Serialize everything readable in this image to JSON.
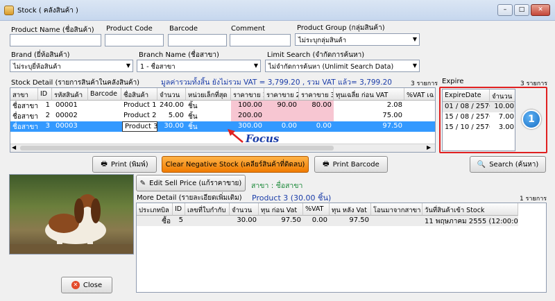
{
  "window": {
    "title": "Stock ( คลังสินค้า )",
    "min": "–",
    "max": "□",
    "close": "✕"
  },
  "filters": {
    "product_name_label": "Product Name (ชื่อสินค้า)",
    "product_code_label": "Product Code",
    "barcode_label": "Barcode",
    "comment_label": "Comment",
    "product_group_label": "Product Group (กลุ่มสินค้า)",
    "product_group_value": "ไม่ระบุกลุ่มสินค้า",
    "brand_label": "Brand (ยี่ห้อสินค้า)",
    "brand_value": "ไม่ระบุยี่ห้อสินค้า",
    "branch_label": "Branch Name (ชื่อสาขา)",
    "branch_value": "1 - ชื่อสาขา",
    "limit_label": "Limit Search (จำกัดการค้นหา)",
    "limit_value": "ไม่จำกัดการค้นหา (Unlimit Search Data)"
  },
  "stock": {
    "label": "Stock Detail (รายการสินค้าในคลังสินค้า)",
    "summary": "มูลค่ารวมทั้งสิ้น ยังไม่รวม VAT = 3,799.20 , รวม VAT แล้ว= 3,799.20",
    "count": "3 รายการ",
    "headers": [
      "สาขา",
      "ID",
      "รหัสสินค้า",
      "Barcode",
      "ชื่อสินค้า",
      "จำนวน",
      "หน่วยเล็กที่สุด",
      "ราคาขาย 1",
      "ราคาขาย 2",
      "ราคาขาย 3",
      "ทุนเฉลี่ย ก่อน VAT",
      "%VAT เฉ"
    ],
    "rows": [
      [
        "ชื่อสาขา",
        "1",
        "00001",
        "Product 1",
        "240.00",
        "ชิ้น",
        "100.00",
        "90.00",
        "80.00",
        "2.08"
      ],
      [
        "ชื่อสาขา",
        "2",
        "00002",
        "Product 2",
        "5.00",
        "ชิ้น",
        "200.00",
        "0.00",
        "0.00",
        "75.00"
      ],
      [
        "ชื่อสาขา",
        "3",
        "00003",
        "Product 3",
        "30.00",
        "ชิ้น",
        "300.00",
        "0.00",
        "0.00",
        "97.50"
      ]
    ],
    "focus_label": "Focus"
  },
  "expire": {
    "label": "Expire",
    "count": "3 รายการ",
    "headers": [
      "ExpireDate",
      "จำนวน"
    ],
    "rows": [
      [
        "01 / 08 / 2570",
        "10.00"
      ],
      [
        "15 / 08 / 2570",
        "7.00"
      ],
      [
        "15 / 10 / 2570",
        "3.00"
      ]
    ],
    "badge": "1",
    "highlight_color": "#e02020"
  },
  "buttons": {
    "print": "Print (พิมพ์)",
    "clear_negative": "Clear Negative Stock (เคลียร์สินค้าที่ติดลบ)",
    "print_barcode": "Print Barcode",
    "search": "Search (ค้นหา)",
    "edit_price": "Edit Sell Price (แก้ราคาขาย)",
    "close": "Close"
  },
  "detail": {
    "branch_text": "สาขา : ชื่อสาขา",
    "label": "More Detail (รายละเอียดเพิ่มเติม)",
    "product_text": "Product 3 (30.00 ชิ้น)",
    "count": "1 รายการ",
    "headers": [
      "ประเภทบิล",
      "ID",
      "เลขที่ใบกำกับ",
      "จำนวน",
      "ทุน ก่อน Vat",
      "%VAT",
      "ทุน หลัง Vat",
      "โอนมาจากสาขา",
      "วันที่สินค้าเข้า Stock"
    ],
    "row": [
      "ซื้อ",
      "5",
      "",
      "30.00",
      "97.50",
      "0.00",
      "97.50",
      "",
      "11 พฤษภาคม 2555 (12:00:00)"
    ]
  }
}
